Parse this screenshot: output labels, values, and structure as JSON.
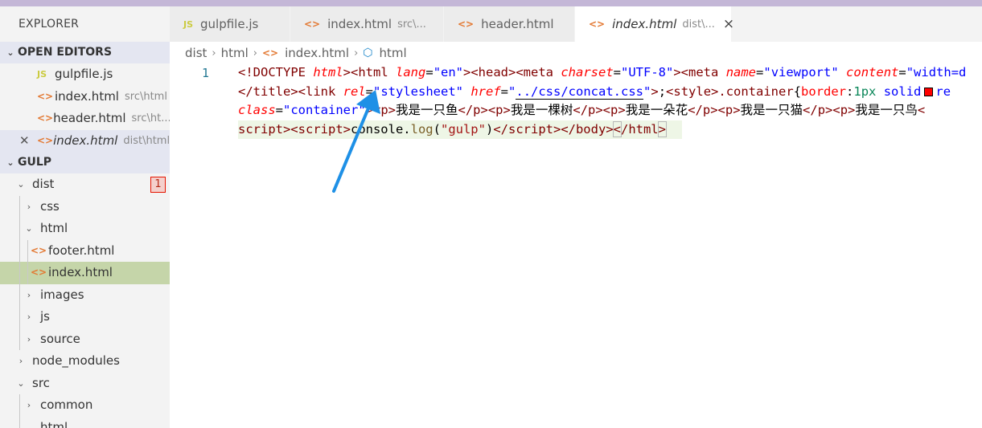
{
  "sidebar": {
    "title": "EXPLORER",
    "open_editors_label": "OPEN EDITORS",
    "open_editors": [
      {
        "icon": "js-file-icon",
        "glyph": "JS",
        "name": "gulpfile.js",
        "desc": ""
      },
      {
        "icon": "html-file-icon",
        "glyph": "<>",
        "name": "index.html",
        "desc": "src\\html"
      },
      {
        "icon": "html-file-icon",
        "glyph": "<>",
        "name": "header.html",
        "desc": "src\\ht..."
      },
      {
        "icon": "html-file-icon",
        "glyph": "<>",
        "name": "index.html",
        "desc": "dist\\html"
      }
    ],
    "project_label": "GULP",
    "badge": "1",
    "tree": [
      {
        "name": "dist"
      },
      {
        "name": "css"
      },
      {
        "name": "html"
      },
      {
        "name": "footer.html"
      },
      {
        "name": "index.html"
      },
      {
        "name": "images"
      },
      {
        "name": "js"
      },
      {
        "name": "source"
      },
      {
        "name": "node_modules"
      },
      {
        "name": "src"
      },
      {
        "name": "common"
      },
      {
        "name": "html"
      }
    ]
  },
  "tabs": [
    {
      "glyph": "JS",
      "name": "gulpfile.js",
      "desc": ""
    },
    {
      "glyph": "<>",
      "name": "index.html",
      "desc": "src\\..."
    },
    {
      "glyph": "<>",
      "name": "header.html",
      "desc": ""
    },
    {
      "glyph": "<>",
      "name": "index.html",
      "desc": "dist\\...",
      "close": "×"
    }
  ],
  "breadcrumb": [
    "dist",
    "html",
    "index.html",
    "html"
  ],
  "editor": {
    "line_number": "1"
  },
  "colors": {
    "accent_bar": "#c4b7d7",
    "selected_row": "#c5d5a9",
    "arrow": "#1e90e6"
  }
}
